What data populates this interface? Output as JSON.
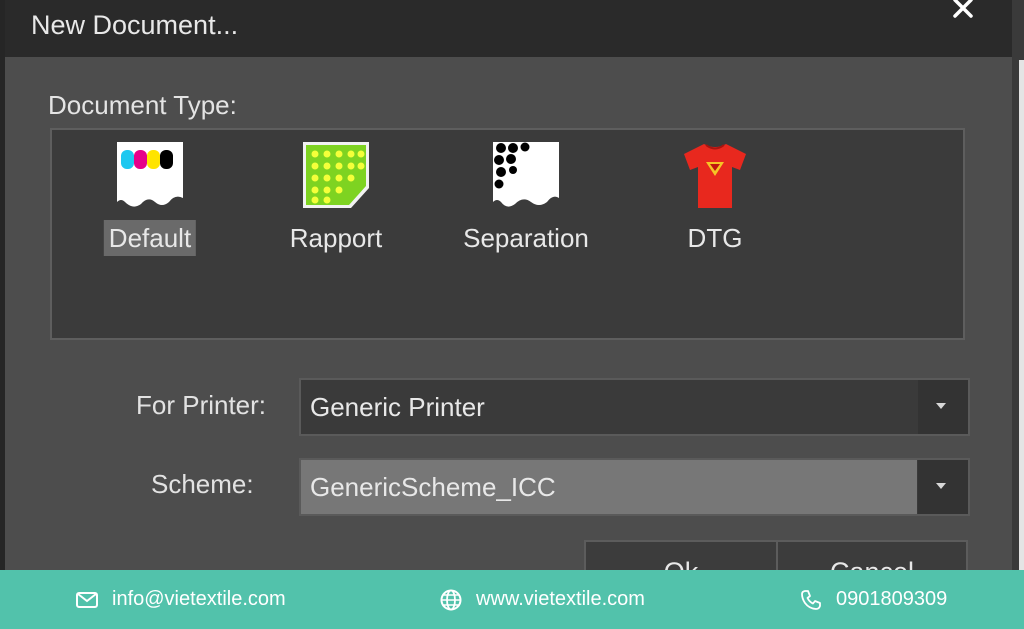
{
  "dialog": {
    "title": "New Document...",
    "close_icon": "close-icon",
    "document_type_label": "Document Type:",
    "document_types": [
      {
        "label": "Default",
        "icon": "default-doc-icon",
        "selected": true
      },
      {
        "label": "Rapport",
        "icon": "rapport-doc-icon",
        "selected": false
      },
      {
        "label": "Separation",
        "icon": "separation-doc-icon",
        "selected": false
      },
      {
        "label": "DTG",
        "icon": "dtg-tshirt-icon",
        "selected": false
      }
    ],
    "printer_label": "For Printer:",
    "printer_value": "Generic Printer",
    "scheme_label": "Scheme:",
    "scheme_value": "GenericScheme_ICC",
    "ok_label": "Ok",
    "cancel_label": "Cancel"
  },
  "footer": {
    "email": "info@vietextile.com",
    "website": "www.vietextile.com",
    "phone": "0901809309",
    "background": "#52c2ab"
  },
  "colors": {
    "titlebar": "#2a2a2a",
    "dialog_bg": "#4d4d4d",
    "panel_bg": "#3b3b3b",
    "tshirt_red": "#e8281e",
    "rapport_green": "#7ed321"
  }
}
